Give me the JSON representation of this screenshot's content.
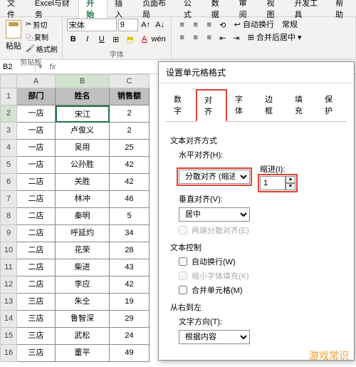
{
  "menu": {
    "tabs": [
      "文件",
      "Excel与财务",
      "开始",
      "插入",
      "页面布局",
      "公式",
      "数据",
      "审阅",
      "视图",
      "开发工具",
      "帮助"
    ],
    "active": 2
  },
  "ribbon": {
    "clipboard": {
      "paste": "粘贴",
      "cut": "剪切",
      "copy": "复制",
      "format": "格式刷",
      "title": "剪贴板"
    },
    "font": {
      "name": "宋体",
      "size": "9",
      "title": "字体"
    },
    "align": {
      "wrap": "自动换行",
      "merge": "合并后居中",
      "normal": "常规"
    }
  },
  "cellref": {
    "name": "B2"
  },
  "columns": [
    "A",
    "B",
    "C"
  ],
  "header_row": [
    "部门",
    "姓名",
    "销售额"
  ],
  "rows": [
    [
      "一店",
      "宋江",
      "2"
    ],
    [
      "一店",
      "卢俊义",
      "2"
    ],
    [
      "一店",
      "吴用",
      "25"
    ],
    [
      "一店",
      "公孙胜",
      "42"
    ],
    [
      "二店",
      "关胜",
      "42"
    ],
    [
      "二店",
      "林冲",
      "46"
    ],
    [
      "二店",
      "秦明",
      "5"
    ],
    [
      "二店",
      "呼延灼",
      "34"
    ],
    [
      "二店",
      "花荣",
      "28"
    ],
    [
      "二店",
      "柴进",
      "43"
    ],
    [
      "二店",
      "李应",
      "42"
    ],
    [
      "三店",
      "朱仝",
      "19"
    ],
    [
      "三店",
      "鲁智深",
      "29"
    ],
    [
      "三店",
      "武松",
      "24"
    ],
    [
      "三店",
      "董平",
      "49"
    ]
  ],
  "dialog": {
    "title": "设置单元格格式",
    "tabs": [
      "数字",
      "对齐",
      "字体",
      "边框",
      "填充",
      "保护"
    ],
    "active_tab": 1,
    "sec_align": "文本对齐方式",
    "h_label": "水平对齐(H):",
    "h_value": "分散对齐 (缩进)",
    "indent_label": "缩进(I):",
    "indent_value": "1",
    "v_label": "垂直对齐(V):",
    "v_value": "居中",
    "justify": "两端分散对齐(E)",
    "sec_ctrl": "文本控制",
    "wrap": "自动换行(W)",
    "shrink": "缩小字体填充(K)",
    "merge": "合并单元格(M)",
    "sec_rtl": "从右到左",
    "dir_label": "文字方向(T):",
    "dir_value": "根据内容"
  },
  "watermark": "游戏常识"
}
